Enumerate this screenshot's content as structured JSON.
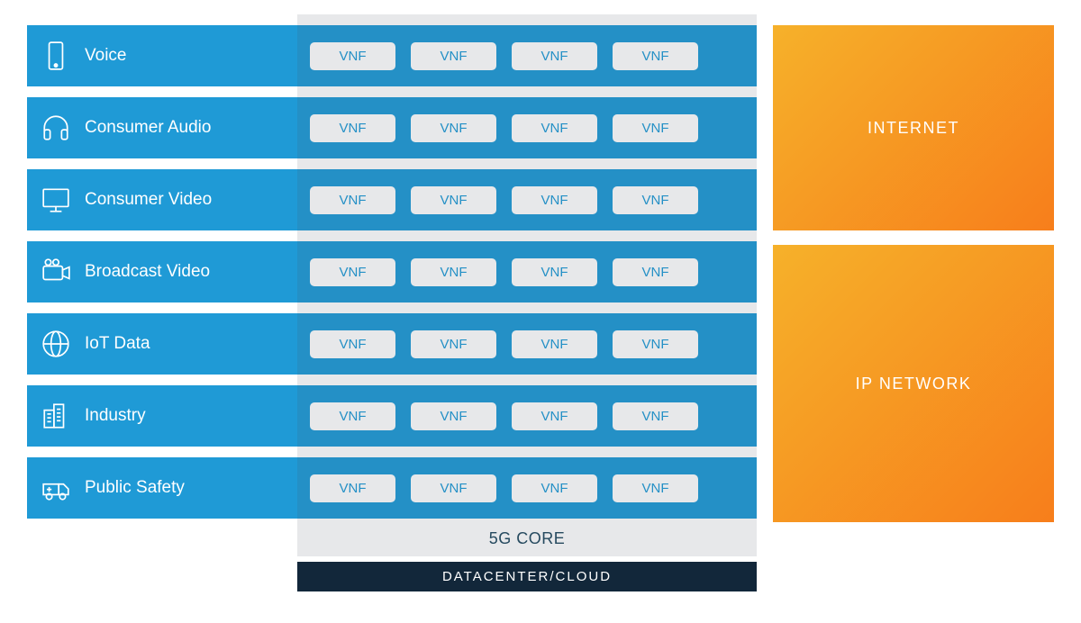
{
  "slices": [
    {
      "icon": "smartphone-icon",
      "label": "Voice",
      "vnfs": [
        "VNF",
        "VNF",
        "VNF",
        "VNF"
      ]
    },
    {
      "icon": "headphones-icon",
      "label": "Consumer Audio",
      "vnfs": [
        "VNF",
        "VNF",
        "VNF",
        "VNF"
      ]
    },
    {
      "icon": "monitor-icon",
      "label": "Consumer Video",
      "vnfs": [
        "VNF",
        "VNF",
        "VNF",
        "VNF"
      ]
    },
    {
      "icon": "camera-icon",
      "label": "Broadcast Video",
      "vnfs": [
        "VNF",
        "VNF",
        "VNF",
        "VNF"
      ]
    },
    {
      "icon": "globe-icon",
      "label": "IoT Data",
      "vnfs": [
        "VNF",
        "VNF",
        "VNF",
        "VNF"
      ]
    },
    {
      "icon": "buildings-icon",
      "label": "Industry",
      "vnfs": [
        "VNF",
        "VNF",
        "VNF",
        "VNF"
      ]
    },
    {
      "icon": "ambulance-icon",
      "label": "Public Safety",
      "vnfs": [
        "VNF",
        "VNF",
        "VNF",
        "VNF"
      ]
    }
  ],
  "core_label": "5G CORE",
  "datacenter_label": "DATACENTER/CLOUD",
  "right": {
    "internet": "INTERNET",
    "ipnet": "IP NETWORK"
  }
}
